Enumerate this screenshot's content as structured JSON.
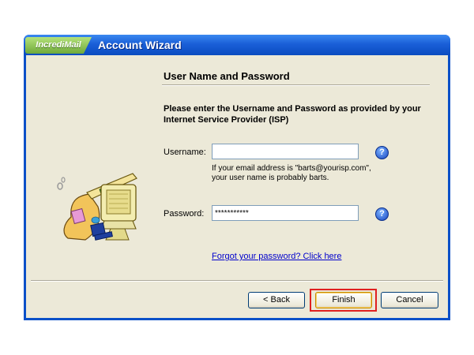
{
  "window": {
    "brand": "IncrediMail",
    "title": "Account Wizard"
  },
  "page": {
    "heading": "User Name and Password",
    "instructions": "Please enter the Username and Password as provided by your Internet Service Provider (ISP)"
  },
  "username": {
    "label": "Username:",
    "value": "",
    "hint_line1": "If your email address is \"barts@yourisp.com\",",
    "hint_line2": "your user name is probably barts."
  },
  "password": {
    "label": "Password:",
    "value": "***********"
  },
  "forgot_link": "Forgot your password? Click here",
  "help_icon_glyph": "?",
  "buttons": {
    "back": "< Back",
    "finish": "Finish",
    "cancel": "Cancel"
  },
  "colors": {
    "title_bar": "#0a50c8",
    "brand_tab": "#8cc450",
    "dialog_bg": "#ece9d8",
    "highlight": "#e02020"
  }
}
